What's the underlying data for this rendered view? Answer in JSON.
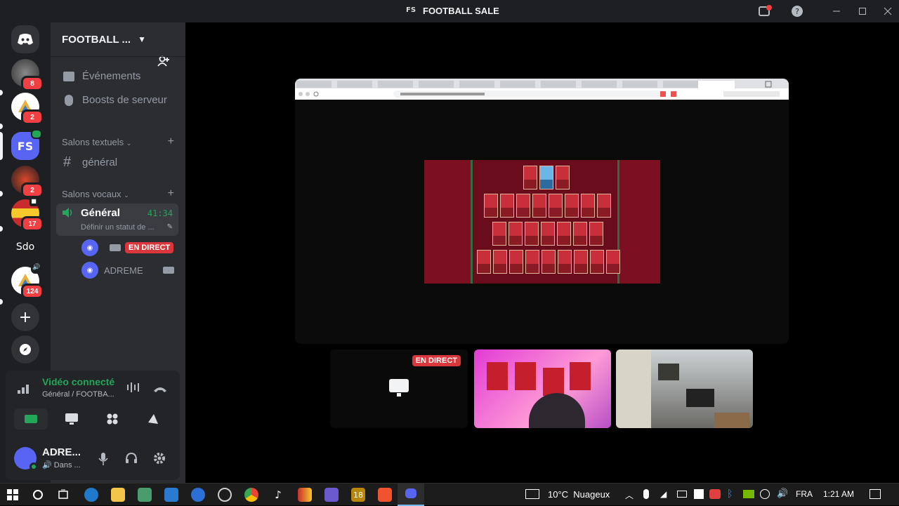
{
  "titlebar": {
    "badge": "FS",
    "title": "FOOTBALL SALE"
  },
  "servers": {
    "items": [
      {
        "name": "server-1",
        "badge": "8"
      },
      {
        "name": "server-2",
        "badge": "2"
      },
      {
        "name": "server-fs",
        "label": "FS"
      },
      {
        "name": "server-4",
        "badge": "2"
      },
      {
        "name": "server-5",
        "badge": "17"
      },
      {
        "name": "server-sdo",
        "label": "Sdo"
      },
      {
        "name": "server-7",
        "badge": "124"
      }
    ]
  },
  "guild": {
    "title": "FOOTBALL ..."
  },
  "channels": {
    "events": "Événements",
    "boosts": "Boosts de serveur",
    "text_category": "Salons textuels",
    "general_text": "général",
    "voice_category": "Salons vocaux",
    "voice_channel": "Général",
    "timer": "41:34",
    "status_hint": "Définir un statut de ...",
    "live_label": "EN DIRECT",
    "user2": "ADREME"
  },
  "voice_panel": {
    "status": "Vidéo connecté",
    "subtitle": "Général / FOOTBA..."
  },
  "user_panel": {
    "name": "ADRE...",
    "status": "Dans ..."
  },
  "tiles": {
    "live_label": "EN DIRECT"
  },
  "taskbar": {
    "weather": "10°C  Nuageux",
    "lang": "FRA",
    "time": "1:21 AM",
    "app_18": "18"
  },
  "colors": {
    "accent": "#5865f2",
    "live": "#da373c",
    "connected": "#23a55a"
  }
}
